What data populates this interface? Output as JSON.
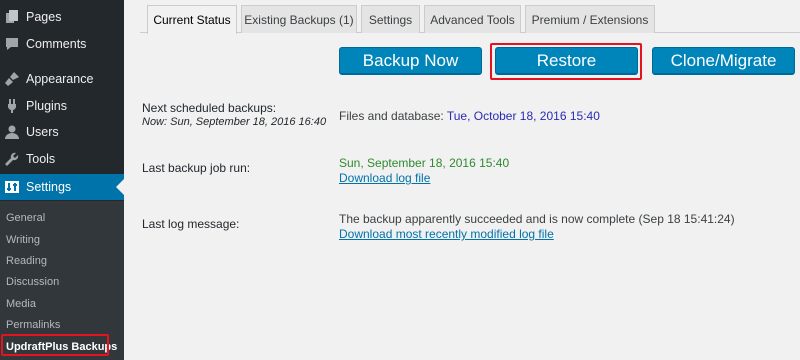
{
  "sidebar": {
    "menu": [
      {
        "label": "Pages",
        "icon": "pages-icon"
      },
      {
        "label": "Comments",
        "icon": "comments-icon"
      },
      {
        "label": "Appearance",
        "icon": "appearance-icon"
      },
      {
        "label": "Plugins",
        "icon": "plugins-icon"
      },
      {
        "label": "Users",
        "icon": "users-icon"
      },
      {
        "label": "Tools",
        "icon": "tools-icon"
      },
      {
        "label": "Settings",
        "icon": "settings-icon"
      }
    ],
    "submenu": [
      "General",
      "Writing",
      "Reading",
      "Discussion",
      "Media",
      "Permalinks",
      "UpdraftPlus Backups"
    ],
    "active_color": "#0073aa"
  },
  "tabs": [
    "Current Status",
    "Existing Backups (1)",
    "Settings",
    "Advanced Tools",
    "Premium / Extensions"
  ],
  "buttons": {
    "backup": "Backup Now",
    "restore": "Restore",
    "clone": "Clone/Migrate"
  },
  "status": {
    "next_label": "Next scheduled backups:",
    "now_label": "Now: Sun, September 18, 2016 16:40",
    "files_label": "Files and database:",
    "files_value": "Tue, October 18, 2016 15:40",
    "last_run_label": "Last backup job run:",
    "last_run_value": "Sun, September 18, 2016 15:40",
    "download_log": "Download log file",
    "last_msg_label": "Last log message:",
    "last_msg_value": "The backup apparently succeeded and is now complete (Sep 18 15:41:24)",
    "download_recent_log": "Download most recently modified log file"
  }
}
